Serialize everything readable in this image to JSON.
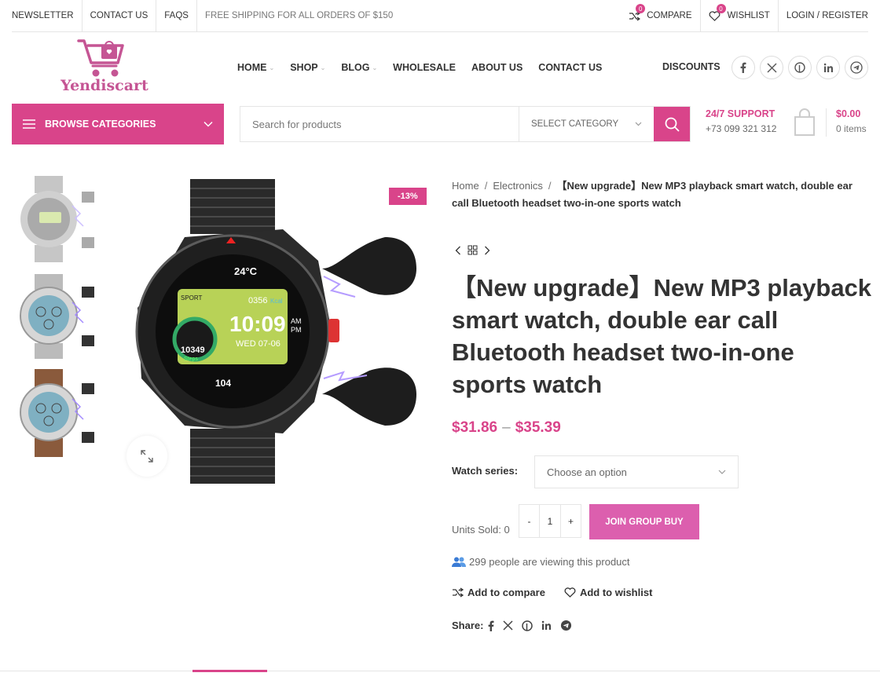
{
  "topbar": {
    "links": [
      "NEWSLETTER",
      "CONTACT US",
      "FAQS"
    ],
    "promo": "FREE SHIPPING FOR ALL ORDERS OF $150",
    "compare_label": "COMPARE",
    "compare_count": "0",
    "wishlist_label": "WISHLIST",
    "wishlist_count": "0",
    "login_label": "LOGIN / REGISTER"
  },
  "logo": {
    "text": "Yendiscart"
  },
  "nav": {
    "items": [
      "HOME",
      "SHOP",
      "BLOG",
      "WHOLESALE",
      "ABOUT US",
      "CONTACT US"
    ],
    "discounts": "DISCOUNTS"
  },
  "browse": {
    "label": "BROWSE CATEGORIES"
  },
  "search": {
    "placeholder": "Search for products",
    "category": "SELECT CATEGORY"
  },
  "support": {
    "title": "24/7 SUPPORT",
    "phone": "+73 099 321 312"
  },
  "cart": {
    "amount": "$0.00",
    "items": "0 items"
  },
  "gallery": {
    "sale_badge": "-13%"
  },
  "breadcrumb": {
    "items": [
      "Home",
      "Electronics"
    ],
    "separator": "/",
    "current": "【New upgrade】New MP3 playback smart watch, double ear call Bluetooth headset two-in-one sports watch"
  },
  "product": {
    "title": "【New upgrade】New MP3 playback smart watch, double ear call Bluetooth headset two-in-one sports watch",
    "price_min": "$31.86",
    "price_sep": "–",
    "price_max": "$35.39",
    "variation_label": "Watch series:",
    "variation_placeholder": "Choose an option",
    "units_sold": "Units Sold: 0",
    "qty_minus": "-",
    "qty_value": "1",
    "qty_plus": "+",
    "group_buy": "JOIN GROUP BUY",
    "viewing": "299 people are viewing this product",
    "add_compare": "Add to compare",
    "add_wishlist": "Add to wishlist",
    "share_label": "Share:"
  },
  "watch_screen": {
    "temp": "24°C",
    "sport": "SPORT",
    "kcal": "0356",
    "kcal_unit": "Kcal",
    "time": "10:09",
    "am": "AM",
    "pm": "PM",
    "date": "WED  07-06",
    "steps": "10349",
    "steps_label": "Steps",
    "heart": "104"
  },
  "colors": {
    "accent": "#d9448a",
    "group_buy": "#dc5fae"
  }
}
